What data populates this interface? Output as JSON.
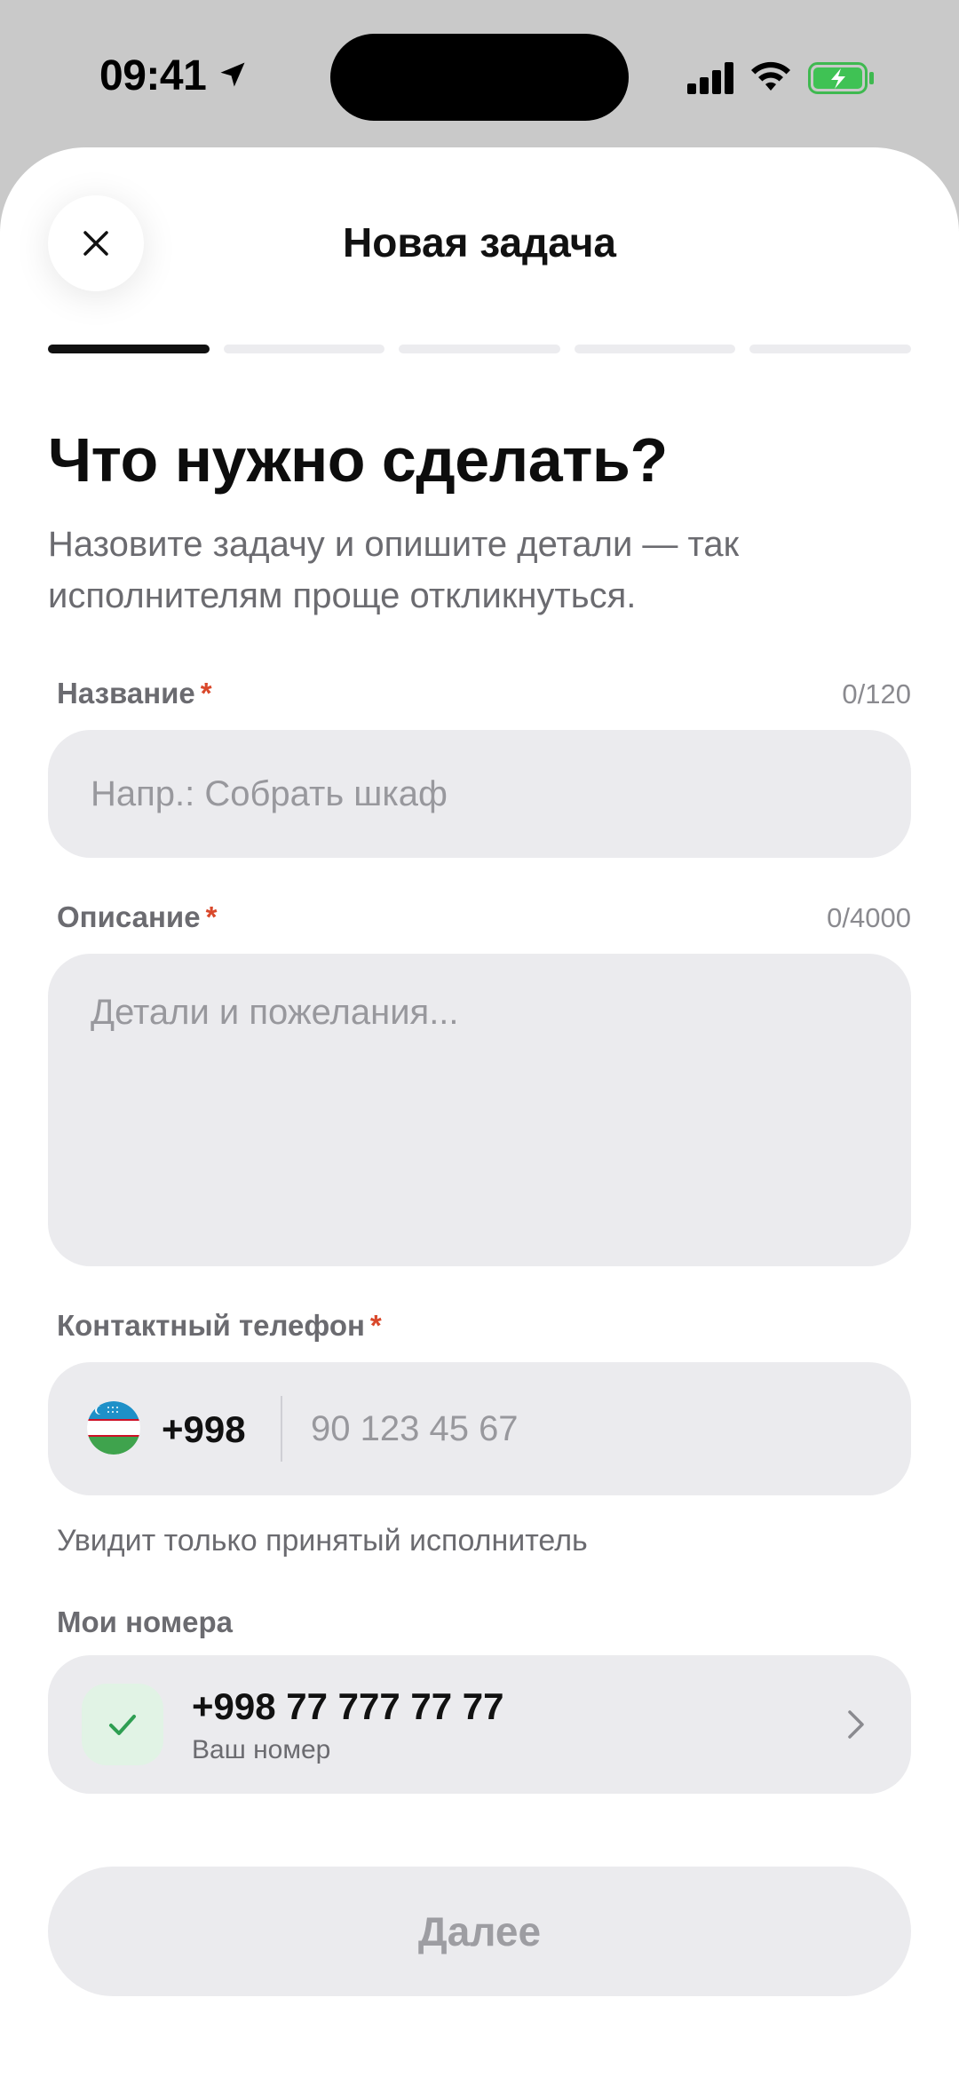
{
  "status_bar": {
    "time": "09:41"
  },
  "header": {
    "title": "Новая задача",
    "close_icon": "close-icon",
    "progress": {
      "total_steps": 5,
      "current_step": 1
    }
  },
  "intro": {
    "heading": "Что нужно сделать?",
    "subtitle": "Назовите задачу и опишите детали — так исполнителям проще откликнуться."
  },
  "name_field": {
    "label": "Название",
    "required_mark": "*",
    "counter": "0/120",
    "value": "",
    "placeholder": "Напр.: Собрать шкаф"
  },
  "description_field": {
    "label": "Описание",
    "required_mark": "*",
    "counter": "0/4000",
    "value": "",
    "placeholder": "Детали и пожелания..."
  },
  "phone_field": {
    "label": "Контактный телефон",
    "required_mark": "*",
    "country_flag": "uzbekistan-flag-icon",
    "country_code": "+998",
    "value": "",
    "placeholder": "90 123 45 67",
    "hint": "Увидит только принятый исполнитель"
  },
  "my_numbers": {
    "label": "Мои номера",
    "items": [
      {
        "number": "+998 77 777 77 77",
        "caption": "Ваш номер",
        "selected": true,
        "icon": "check-icon"
      }
    ]
  },
  "footer": {
    "next_label": "Далее",
    "enabled": false
  },
  "colors": {
    "accent": "#111111",
    "required": "#D9482B",
    "field_bg": "#EBEBEE",
    "check_green": "#2E9E52",
    "check_bg": "#E1F3E5"
  }
}
